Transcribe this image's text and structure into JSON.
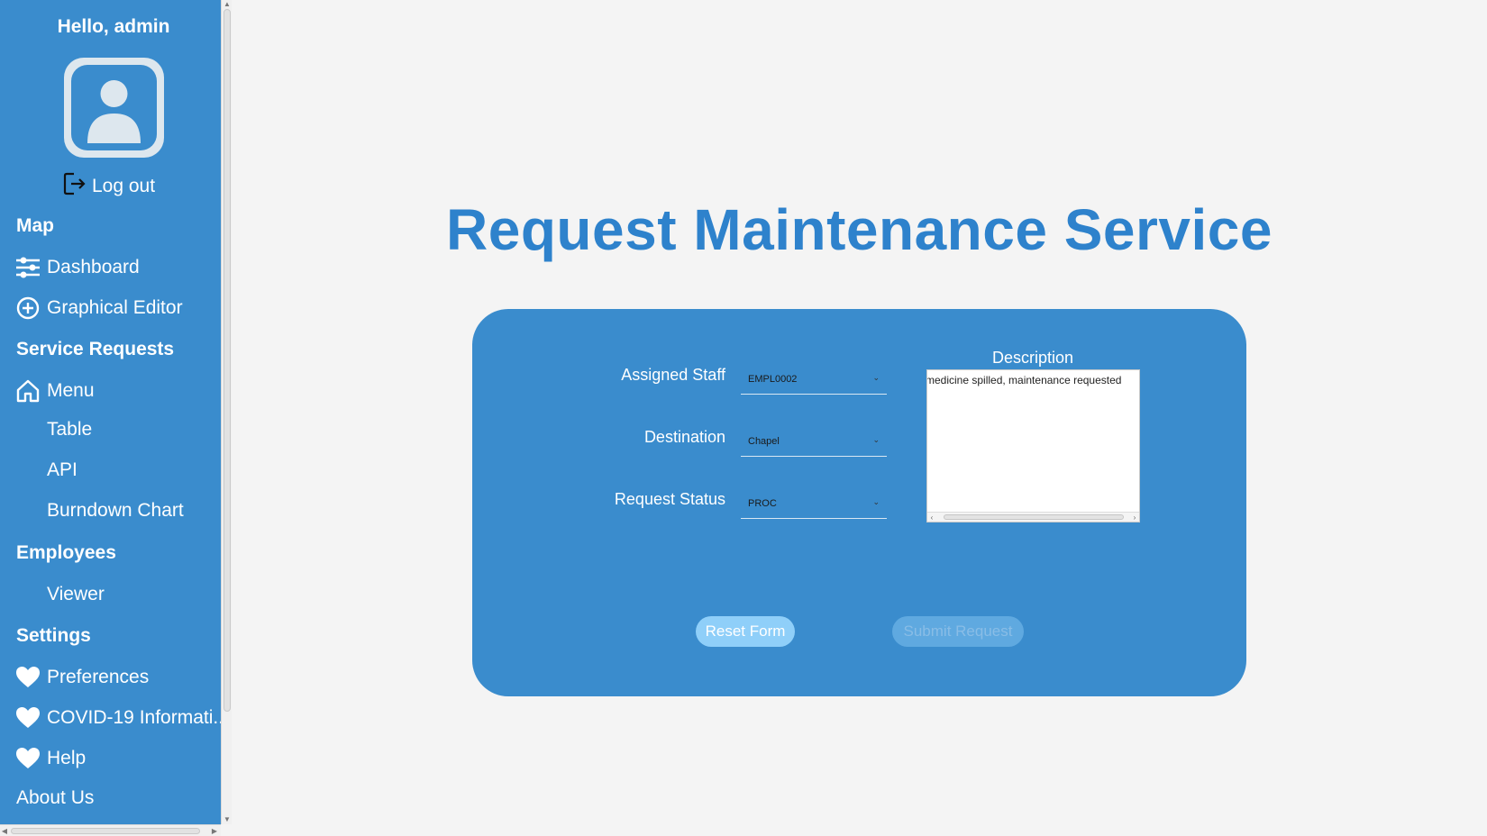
{
  "sidebar": {
    "greeting": "Hello, admin",
    "logout_label": "Log out",
    "sections": {
      "map": "Map",
      "service_requests": "Service Requests",
      "employees": "Employees",
      "settings": "Settings"
    },
    "items": {
      "dashboard": "Dashboard",
      "graphical_editor": "Graphical Editor",
      "menu": "Menu",
      "table": "Table",
      "api": "API",
      "burndown_chart": "Burndown Chart",
      "viewer": "Viewer",
      "preferences": "Preferences",
      "covid": "COVID-19 Informati...",
      "help": "Help",
      "about_us": "About Us"
    },
    "icons": [
      "user-avatar-icon",
      "logout-icon",
      "sliders-icon",
      "plus-circle-icon",
      "home-icon",
      "heart-icon"
    ]
  },
  "main": {
    "title": "Request Maintenance Service",
    "form": {
      "assigned_staff_label": "Assigned Staff",
      "assigned_staff_value": "EMPL0002",
      "destination_label": "Destination",
      "destination_value": "Chapel",
      "request_status_label": "Request Status",
      "request_status_value": "PROC",
      "description_label": "Description",
      "description_value": "medicine spilled, maintenance requested",
      "reset_label": "Reset Form",
      "submit_label": "Submit Request"
    }
  },
  "colors": {
    "sidebar_bg": "#3a8ccd",
    "panel_bg": "#3a8ccd",
    "title": "#2e82cc",
    "page_bg": "#f4f4f4",
    "reset_button": "#8fcff9",
    "submit_button_disabled": "#5fa9e0"
  }
}
